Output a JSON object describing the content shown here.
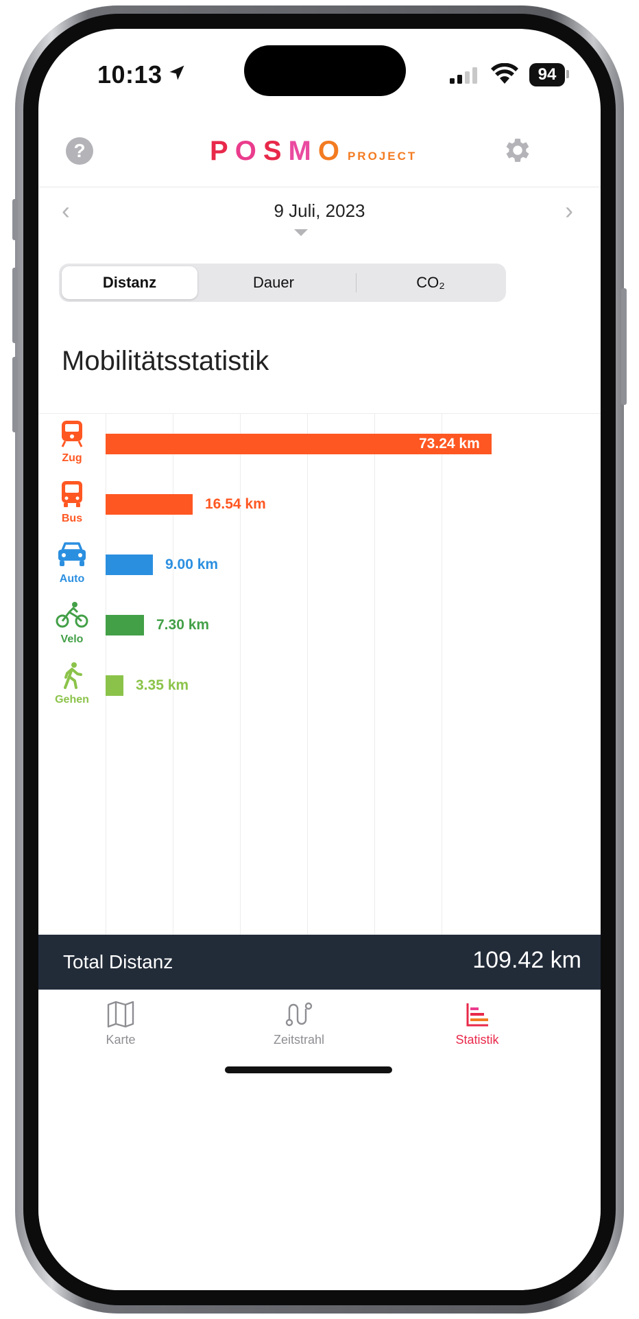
{
  "status_bar": {
    "time": "10:13",
    "battery": "94"
  },
  "header": {
    "help_icon": "question-circle-icon",
    "logo_letters": [
      {
        "char": "P",
        "color": "#e8294a"
      },
      {
        "char": "O",
        "color": "#ea3c8d"
      },
      {
        "char": "S",
        "color": "#e8294a"
      },
      {
        "char": "M",
        "color": "#ea4aa0"
      },
      {
        "char": "O",
        "color": "#f37b21"
      }
    ],
    "logo_sub": "PROJECT",
    "settings_icon": "gear-icon"
  },
  "date_nav": {
    "prev": "‹",
    "date": "9 Juli, 2023",
    "next": "›"
  },
  "segments": {
    "distanz": "Distanz",
    "dauer": "Dauer",
    "co2": "CO₂",
    "active": "Distanz"
  },
  "title": "Mobilitätsstatistik",
  "chart_data": {
    "type": "bar",
    "orientation": "horizontal",
    "categories": [
      "Zug",
      "Bus",
      "Auto",
      "Velo",
      "Gehen"
    ],
    "values": [
      73.24,
      16.54,
      9.0,
      7.3,
      3.35
    ],
    "value_labels": [
      "73.24 km",
      "16.54 km",
      "9.00 km",
      "7.30 km",
      "3.35 km"
    ],
    "colors": [
      "#ff5722",
      "#ff5722",
      "#2b8fe0",
      "#43a047",
      "#8bc34a"
    ],
    "icons": [
      "train-icon",
      "bus-icon",
      "car-icon",
      "bicycle-icon",
      "walking-icon"
    ],
    "unit": "km",
    "xlim": [
      0,
      73.24
    ],
    "grid": true
  },
  "total": {
    "label": "Total Distanz",
    "value": "109.42 km"
  },
  "tabs": [
    {
      "label": "Karte",
      "icon": "map-icon",
      "active": false
    },
    {
      "label": "Zeitstrahl",
      "icon": "timeline-route-icon",
      "active": false
    },
    {
      "label": "Statistik",
      "icon": "bar-chart-icon",
      "active": true
    }
  ]
}
